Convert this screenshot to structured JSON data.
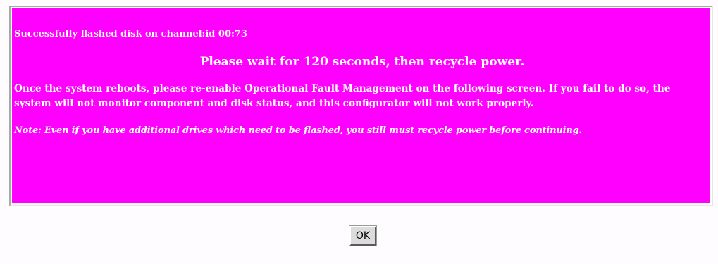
{
  "dialog": {
    "status_line": "Successfully flashed disk on channel:id 00:73",
    "wait_message": "Please wait for 120 seconds, then recycle power.",
    "body_text": "Once the system reboots, please re-enable Operational Fault Management on the following screen. If you fail to do so, the system will not monitor component and disk status, and this configurator will not work properly.",
    "note_text": "Note: Even if you have additional drives which need to be flashed, you still must recycle power before continuing.",
    "background_color": "#ff00ff",
    "text_color": "#ffffff"
  },
  "buttons": {
    "ok_label": "OK"
  }
}
